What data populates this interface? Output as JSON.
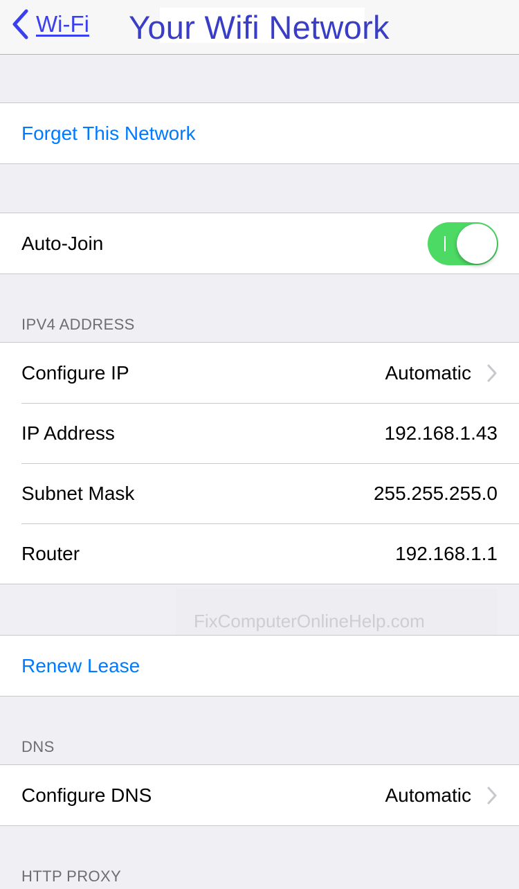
{
  "navbar": {
    "back_label": "Wi-Fi",
    "title": "Your Wifi Network"
  },
  "forget": {
    "label": "Forget This Network"
  },
  "auto_join": {
    "label": "Auto-Join",
    "enabled": true,
    "toggle_glyph": "I"
  },
  "ipv4": {
    "header": "IPV4 ADDRESS",
    "rows": [
      {
        "label": "Configure IP",
        "value": "Automatic",
        "chevron": true
      },
      {
        "label": "IP Address",
        "value": "192.168.1.43"
      },
      {
        "label": "Subnet Mask",
        "value": "255.255.255.0"
      },
      {
        "label": "Router",
        "value": "192.168.1.1"
      }
    ]
  },
  "watermark": "FixComputerOnlineHelp.com",
  "renew": {
    "label": "Renew Lease"
  },
  "dns": {
    "header": "DNS",
    "configure_label": "Configure DNS",
    "configure_value": "Automatic"
  },
  "http_proxy": {
    "header": "HTTP PROXY"
  },
  "colors": {
    "accent": "#007aff",
    "toggle_on": "#4cd964",
    "title": "#3a3ec7",
    "background": "#efeff4"
  },
  "icons": {
    "back": "chevron-left-icon",
    "disclosure": "chevron-right-icon"
  }
}
